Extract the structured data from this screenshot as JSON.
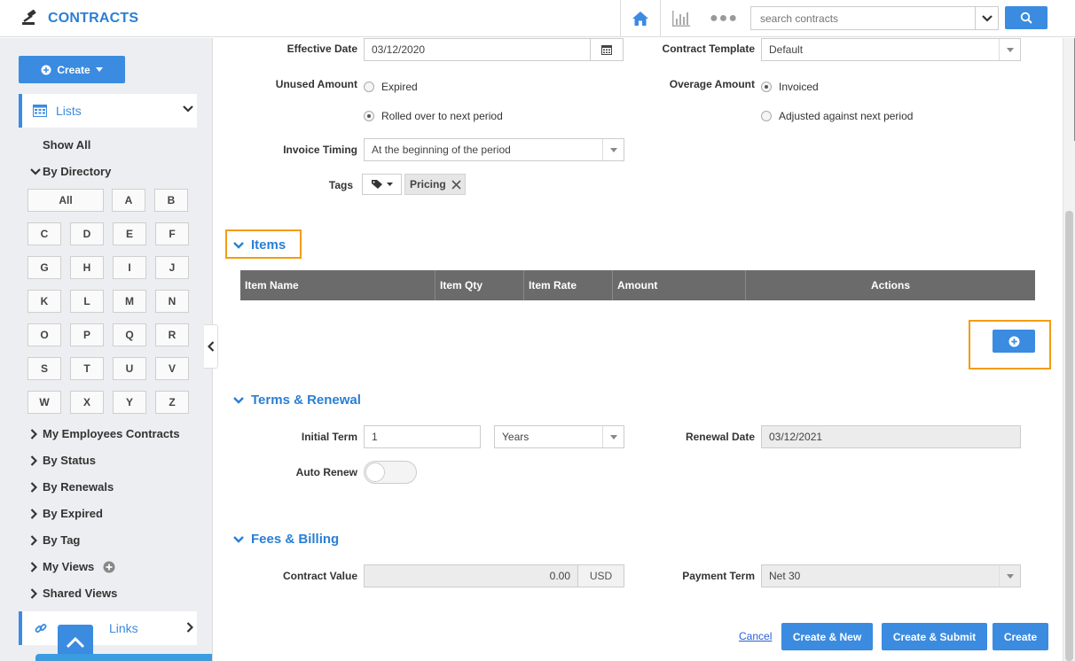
{
  "app": {
    "title": "CONTRACTS"
  },
  "header": {
    "search": {
      "placeholder": "search contracts"
    }
  },
  "sidebar": {
    "create_label": "Create",
    "lists_label": "Lists",
    "show_all": "Show All",
    "by_directory": "By Directory",
    "directory_letters": [
      "All",
      "A",
      "B",
      "C",
      "D",
      "E",
      "F",
      "G",
      "H",
      "I",
      "J",
      "K",
      "L",
      "M",
      "N",
      "O",
      "P",
      "Q",
      "R",
      "S",
      "T",
      "U",
      "V",
      "W",
      "X",
      "Y",
      "Z"
    ],
    "links": [
      "My Employees Contracts",
      "By Status",
      "By Renewals",
      "By Expired",
      "By Tag",
      "My Views",
      "Shared Views"
    ],
    "quick_links_label": "Links"
  },
  "form": {
    "effective_date": {
      "label": "Effective Date",
      "value": "03/12/2020"
    },
    "contract_template": {
      "label": "Contract Template",
      "value": "Default"
    },
    "unused_amount": {
      "label": "Unused Amount",
      "options": [
        "Expired",
        "Rolled over to next period"
      ],
      "selected": 1
    },
    "overage_amount": {
      "label": "Overage Amount",
      "options": [
        "Invoiced",
        "Adjusted against next period"
      ],
      "selected": 0
    },
    "invoice_timing": {
      "label": "Invoice Timing",
      "value": "At the beginning of the period"
    },
    "tags": {
      "label": "Tags",
      "chips": [
        "Pricing"
      ]
    }
  },
  "items": {
    "title": "Items",
    "columns": [
      "Item Name",
      "Item Qty",
      "Item Rate",
      "Amount",
      "Actions"
    ]
  },
  "terms": {
    "title": "Terms & Renewal",
    "initial_term": {
      "label": "Initial Term",
      "value": "1",
      "unit": "Years"
    },
    "renewal_date": {
      "label": "Renewal Date",
      "value": "03/12/2021"
    },
    "auto_renew": {
      "label": "Auto Renew",
      "on": false
    }
  },
  "fees": {
    "title": "Fees & Billing",
    "contract_value": {
      "label": "Contract Value",
      "value": "0.00",
      "currency": "USD"
    },
    "payment_term": {
      "label": "Payment Term",
      "value": "Net 30"
    }
  },
  "actions": {
    "cancel": "Cancel",
    "create_new": "Create & New",
    "create_submit": "Create & Submit",
    "create": "Create"
  },
  "colors": {
    "accent": "#3b8be0",
    "highlight": "#f39c12",
    "table_header": "#6b6b6b"
  }
}
